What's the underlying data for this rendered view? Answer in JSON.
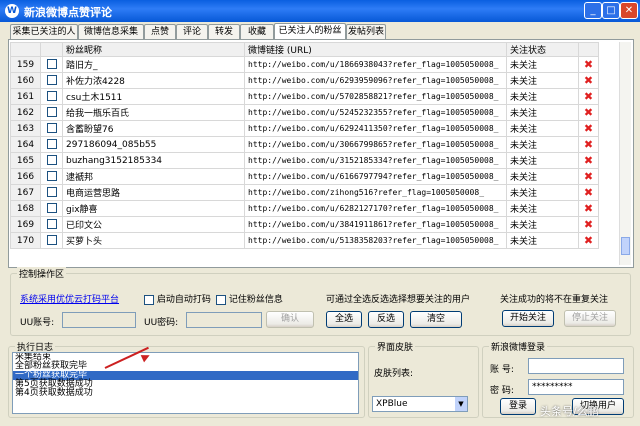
{
  "window": {
    "title": "新浪微博点赞评论",
    "icon": "weibo-icon"
  },
  "tabs": [
    "采集已关注的人",
    "微博信息采集",
    "点赞",
    "评论",
    "转发",
    "收藏",
    "已关注人的粉丝",
    "发帖列表"
  ],
  "active_tab": "已关注人的粉丝",
  "grid": {
    "headers": [
      "粉丝昵称",
      "微博链接 (URL)",
      "关注状态"
    ],
    "rows": [
      {
        "n": "159",
        "name": "踏旧方_",
        "url": "http://weibo.com/u/1866938043?refer_flag=1005050008_",
        "status": "未关注"
      },
      {
        "n": "160",
        "name": "补佐力浓4228",
        "url": "http://weibo.com/u/6293959096?refer_flag=1005050008_",
        "status": "未关注"
      },
      {
        "n": "161",
        "name": "csu土木1511",
        "url": "http://weibo.com/u/5702858821?refer_flag=1005050008_",
        "status": "未关注"
      },
      {
        "n": "162",
        "name": "给我一瓶乐百氏",
        "url": "http://weibo.com/u/5245232355?refer_flag=1005050008_",
        "status": "未关注"
      },
      {
        "n": "163",
        "name": "含蓄盼望76",
        "url": "http://weibo.com/u/6292411350?refer_flag=1005050008_",
        "status": "未关注"
      },
      {
        "n": "164",
        "name": "297186094_085b55",
        "url": "http://weibo.com/u/3066799865?refer_flag=1005050008_",
        "status": "未关注"
      },
      {
        "n": "165",
        "name": "buzhang3152185334",
        "url": "http://weibo.com/u/3152185334?refer_flag=1005050008_",
        "status": "未关注"
      },
      {
        "n": "166",
        "name": "逮褫邦",
        "url": "http://weibo.com/u/6166797794?refer_flag=1005050008_",
        "status": "未关注"
      },
      {
        "n": "167",
        "name": "电商运营思路",
        "url": "http://weibo.com/zihong516?refer_flag=1005050008_",
        "status": "未关注"
      },
      {
        "n": "168",
        "name": "gix静喜",
        "url": "http://weibo.com/u/6282127170?refer_flag=1005050008_",
        "status": "未关注"
      },
      {
        "n": "169",
        "name": "已印文公",
        "url": "http://weibo.com/u/3841911861?refer_flag=1005050008_",
        "status": "未关注"
      },
      {
        "n": "170",
        "name": "买萝卜头",
        "url": "http://weibo.com/u/5138358203?refer_flag=1005050008_",
        "status": "未关注"
      }
    ]
  },
  "control": {
    "group_label": "控制操作区",
    "platform_link": "系统采用优优云打码平台",
    "auto_captcha": "启动自动打码",
    "remember_fans": "记住粉丝信息",
    "hint": "可通过全选反选选择想要关注的用户",
    "uu_account_label": "UU账号:",
    "uu_password_label": "UU密码:",
    "confirm": "确认",
    "select_all": "全选",
    "invert": "反选",
    "clear": "清空",
    "follow_hint": "关注成功的将不在重复关注",
    "start_follow": "开始关注",
    "stop_follow": "停止关注"
  },
  "log": {
    "label": "执行日志",
    "lines": [
      "采集结束",
      "全部粉丝获取完毕",
      "一个粉丝获取完毕",
      "第5页获取数据成功",
      "第4页获取数据成功"
    ],
    "selected_index": 2
  },
  "skin": {
    "label": "界面皮肤",
    "list_label": "皮肤列表:",
    "value": "XPBlue"
  },
  "login": {
    "label": "新浪微博登录",
    "account_label": "账 号:",
    "password_label": "密 码:",
    "password_value": "*********",
    "login_button": "登录",
    "switch_button": "切换用户"
  },
  "watermark": "头条号/么鹏"
}
